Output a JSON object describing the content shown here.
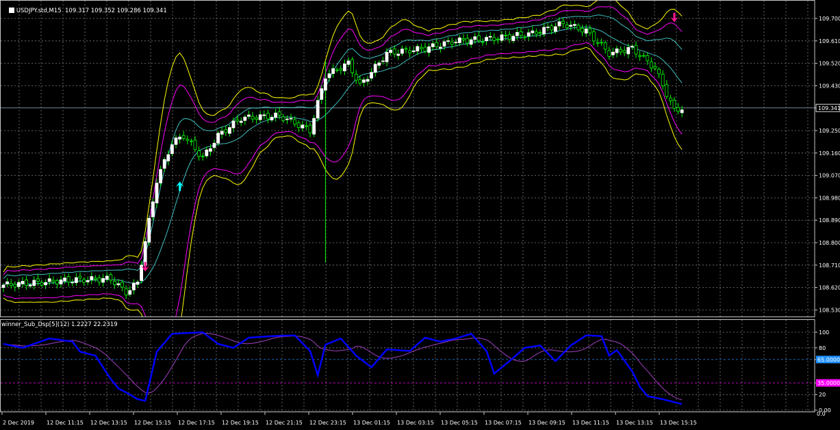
{
  "main_window": {
    "symbol": "USDJPY.std,M15",
    "ohlc": [
      "109.317",
      "109.352",
      "109.286",
      "109.341"
    ],
    "current_price_label": "109.341",
    "price_axis_labels": [
      "109.700",
      "109.610",
      "109.520",
      "109.430",
      "109.341",
      "109.250",
      "109.160",
      "109.070",
      "108.980",
      "108.890",
      "108.800",
      "108.710",
      "108.620",
      "108.530"
    ]
  },
  "indicator_window": {
    "title": "winner_Sub_Dsp[5](12) 1.2227 22.2319",
    "axis_labels": [
      "100",
      "80",
      "65.0000",
      "35.0000",
      "20",
      "0.00"
    ],
    "level_high": "65.0000",
    "level_low": "35.0000",
    "extra_label": "0.0"
  },
  "time_axis": [
    "2 Dec 2019",
    "12 Dec 11:15",
    "12 Dec 13:15",
    "12 Dec 15:15",
    "12 Dec 17:15",
    "12 Dec 19:15",
    "12 Dec 21:15",
    "12 Dec 23:15",
    "13 Dec 01:15",
    "13 Dec 03:15",
    "13 Dec 05:15",
    "13 Dec 07:15",
    "13 Dec 09:15",
    "13 Dec 11:15",
    "13 Dec 13:15",
    "13 Dec 15:15"
  ],
  "colors": {
    "background": "#000000",
    "grid": "#7f7f7f",
    "bull": "#ffffff",
    "bear": "#00ff00",
    "wick": "#00ff00",
    "band_outer": "#ffff00",
    "band_middle": "#ff00ff",
    "band_inner": "#40c0c0",
    "sell_arrow": "#ff1493",
    "buy_arrow": "#00ffff",
    "osc_main": "#0000ff",
    "osc_signal": "#a040c0",
    "level_high": "#1e90ff",
    "level_low": "#ff00ff"
  },
  "arrows": [
    {
      "type": "sell",
      "label": "sell-arrow"
    },
    {
      "type": "buy",
      "label": "buy-arrow"
    },
    {
      "type": "sell",
      "label": "sell-arrow"
    }
  ]
}
